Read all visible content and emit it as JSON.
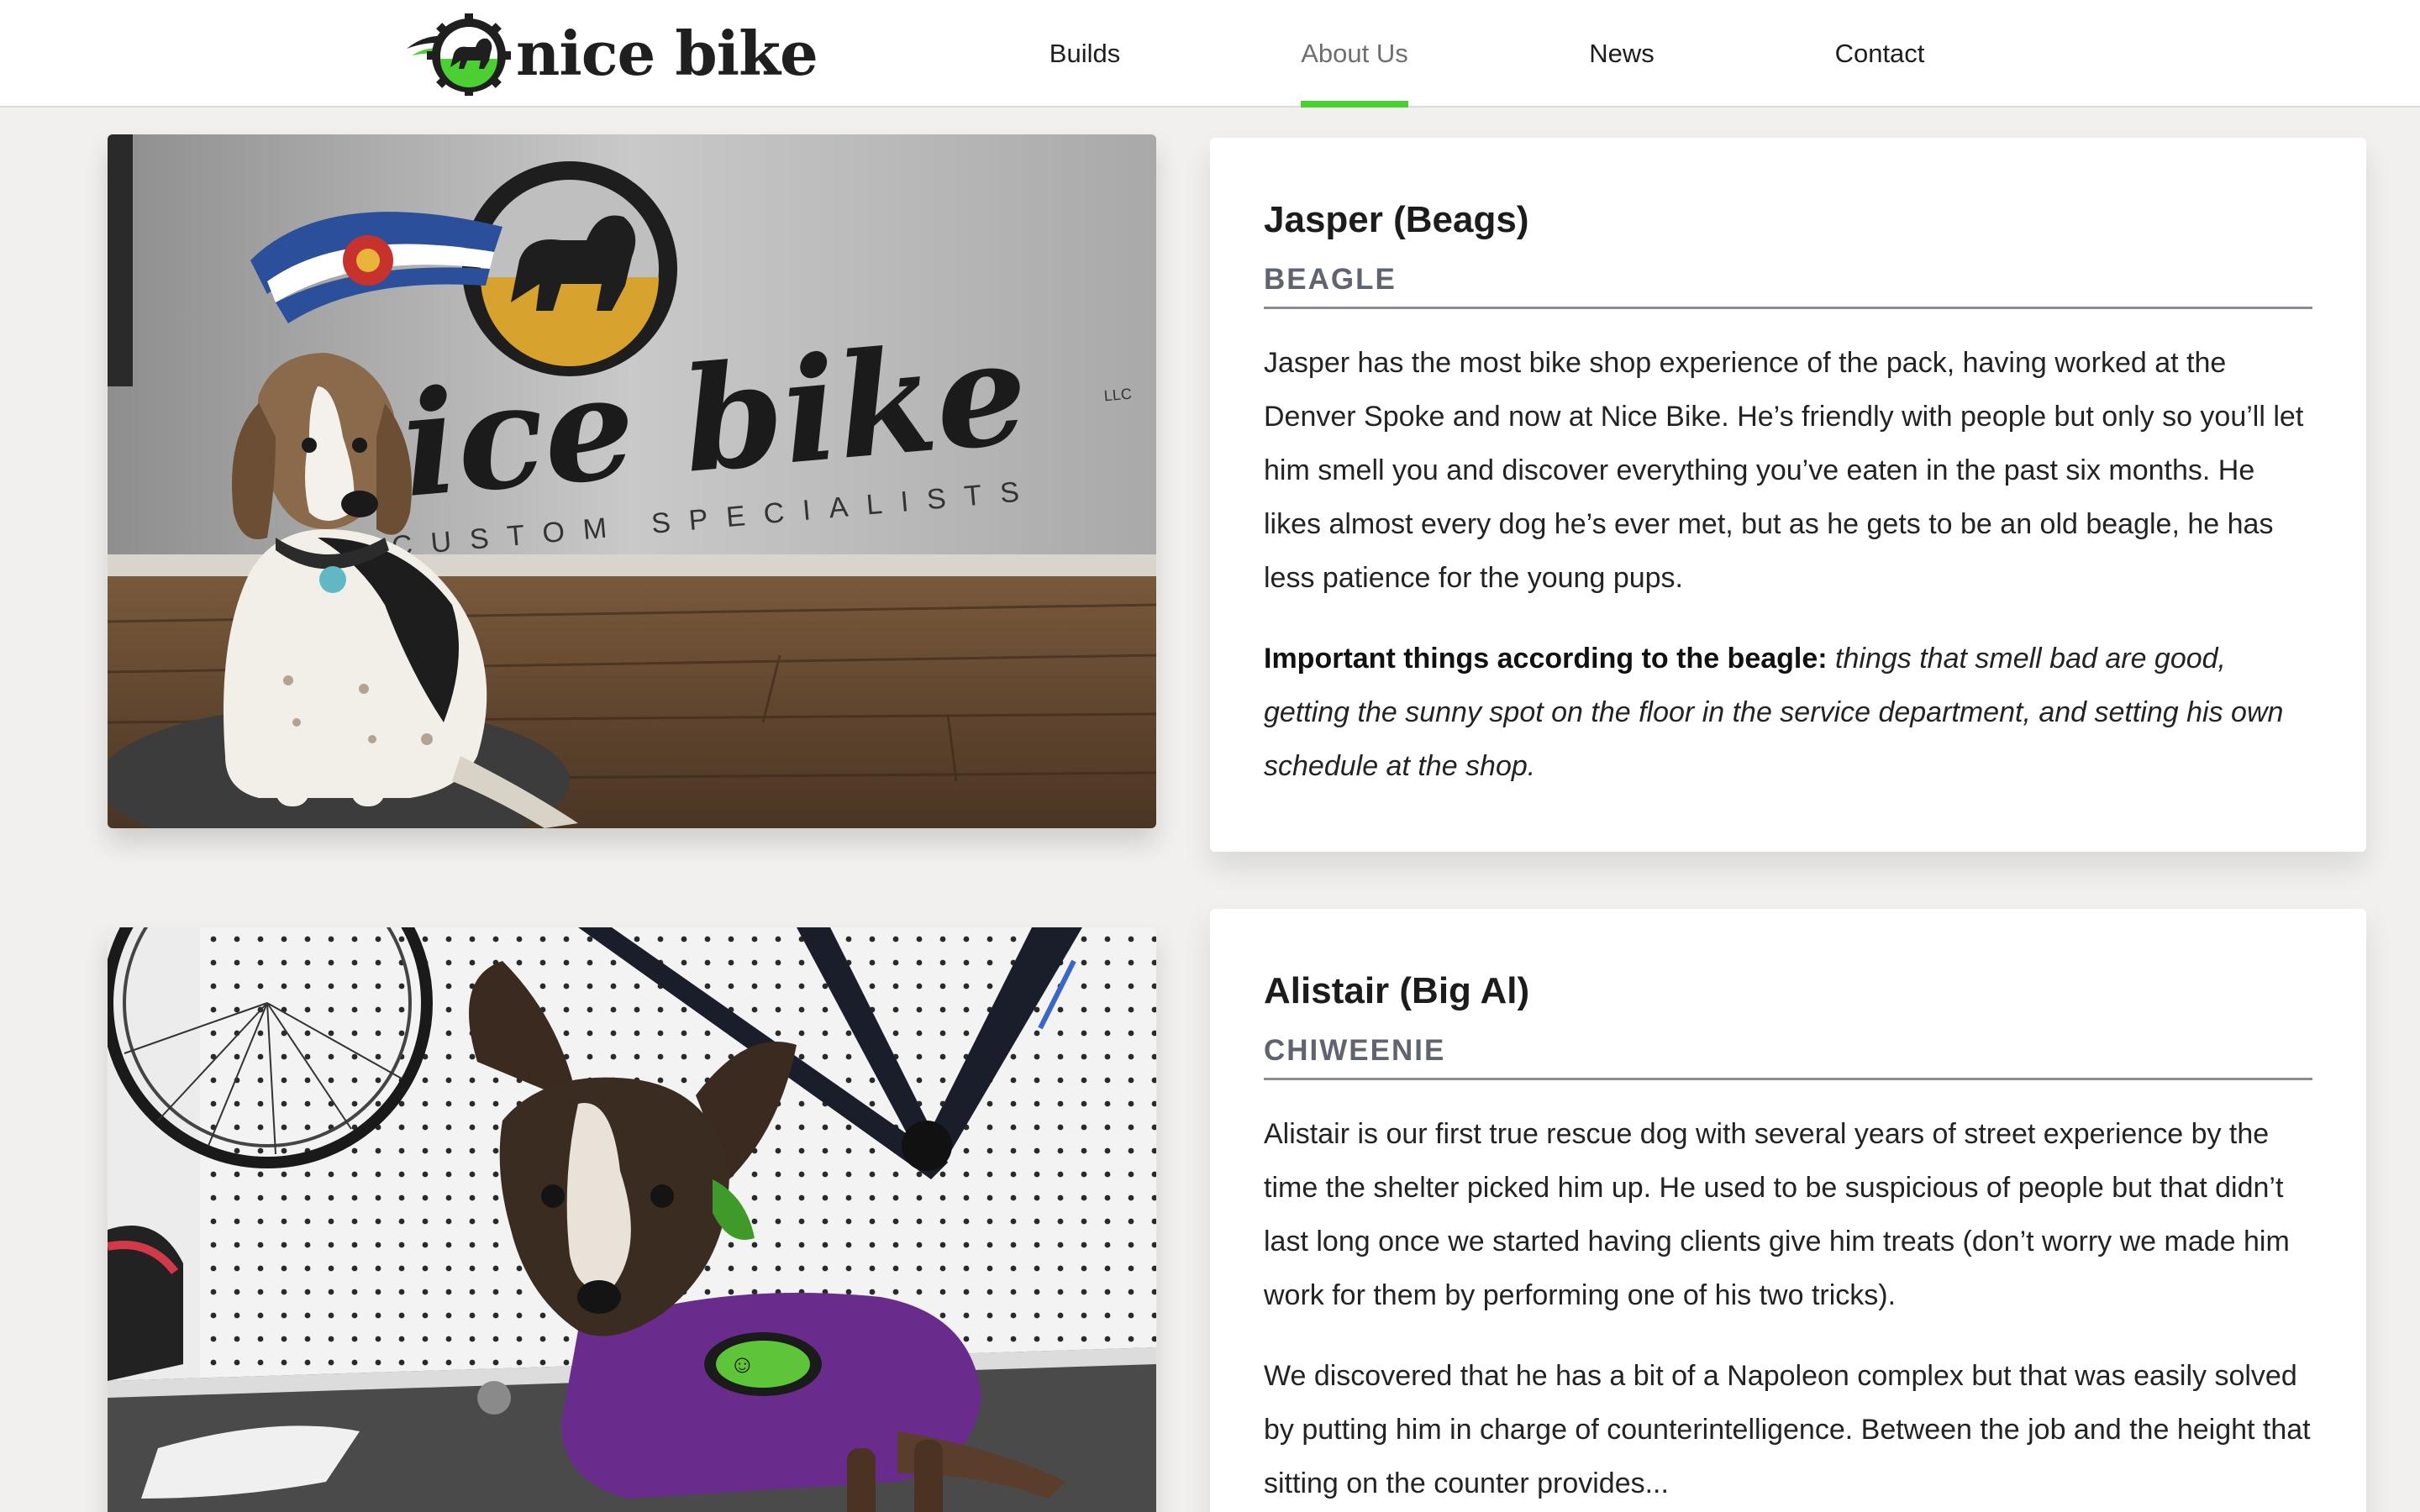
{
  "brand": {
    "name": "nice bike",
    "logo_icon": "lion-gear-logo-icon",
    "colors": {
      "accent_green": "#4ccf33",
      "text_dark": "#1c1c1c",
      "breed_gray": "#5f6470"
    }
  },
  "nav": {
    "items": [
      {
        "label": "Builds",
        "active": false
      },
      {
        "label": "About Us",
        "active": true
      },
      {
        "label": "News",
        "active": false
      },
      {
        "label": "Contact",
        "active": false
      }
    ]
  },
  "dogs": [
    {
      "name": "Jasper (Beags)",
      "breed": "BEAGLE",
      "photo": "beagle-photo",
      "bio": "Jasper has the most bike shop experience of the pack, having worked at the Denver Spoke and now at Nice Bike. He’s friendly with people but only so you’ll let him smell you and discover everything you’ve eaten in the past six months. He likes almost every dog he’s ever met, but as he gets to be an old beagle, he has less patience for the young pups.",
      "important_label": "Important things according to the beagle:",
      "important_text": "things that smell bad are good, getting the sunny spot on the floor in the service department, and setting his own schedule at the shop.",
      "sign_text": "nice bike",
      "sign_subtext": "CUSTOM SPECIALISTS",
      "sign_llc": "LLC"
    },
    {
      "name": "Alistair (Big Al)",
      "breed": "CHIWEENIE",
      "photo": "chiweenie-photo",
      "bio": "Alistair is our first true rescue dog with several years of street experience by the time the shelter picked him up. He used to be suspicious of people but that didn’t last long once we started having clients give him treats (don’t worry we made him work for them by performing one of his two tricks).",
      "bio2": "We discovered that he has a bit of a Napoleon complex but that was easily solved by putting him in charge of counterintelligence. Between the job and the height that sitting on the counter provides..."
    }
  ]
}
